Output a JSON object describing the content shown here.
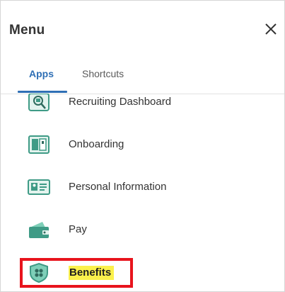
{
  "menu": {
    "title": "Menu",
    "close_icon": "close-icon"
  },
  "tabs": [
    {
      "label": "Apps",
      "active": true
    },
    {
      "label": "Shortcuts",
      "active": false
    }
  ],
  "apps": [
    {
      "label": "Recruiting Dashboard",
      "icon": "recruiting-dashboard-icon"
    },
    {
      "label": "Onboarding",
      "icon": "onboarding-icon"
    },
    {
      "label": "Personal Information",
      "icon": "personal-information-icon"
    },
    {
      "label": "Pay",
      "icon": "pay-icon"
    },
    {
      "label": "Benefits",
      "icon": "benefits-icon",
      "highlighted": true
    }
  ],
  "colors": {
    "accent": "#2f6fb5",
    "icon_teal": "#3f9b86",
    "highlight_box": "#e8141d",
    "text_highlight": "#fbf14c"
  }
}
